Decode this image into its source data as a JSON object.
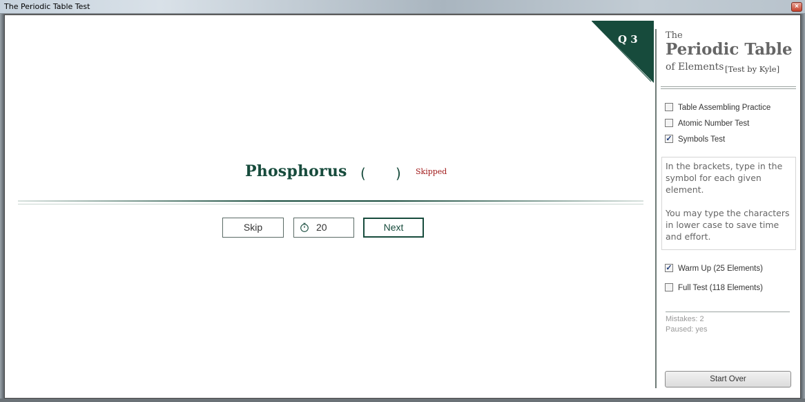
{
  "window": {
    "title": "The Periodic Table Test",
    "close_glyph": "×"
  },
  "question": {
    "label": "Q 3",
    "badge_color": "#174b3c"
  },
  "quiz": {
    "element_name": "Phosphorus",
    "bracket_open": "(",
    "bracket_close": ")",
    "answer_value": "",
    "status_note": "Skipped"
  },
  "controls": {
    "skip_label": "Skip",
    "timer_value": "20",
    "next_label": "Next"
  },
  "brand": {
    "the": "The",
    "main": "Periodic Table",
    "of_elements": "of Elements",
    "by": "[Test by Kyle]"
  },
  "modes": [
    {
      "label": "Table Assembling Practice",
      "checked": false
    },
    {
      "label": "Atomic Number Test",
      "checked": false
    },
    {
      "label": "Symbols Test",
      "checked": true
    }
  ],
  "instructions": [
    "In the brackets, type in the symbol for each given element.",
    "You may type the characters in lower case to save time and effort."
  ],
  "sets": [
    {
      "label": "Warm Up (25 Elements)",
      "checked": true
    },
    {
      "label": "Full Test (118 Elements)",
      "checked": false
    }
  ],
  "stats": {
    "mistakes": "Mistakes: 2",
    "paused": "Paused: yes"
  },
  "start_over_label": "Start Over",
  "colors": {
    "accent": "#174b3c",
    "skipped": "#a01818"
  }
}
